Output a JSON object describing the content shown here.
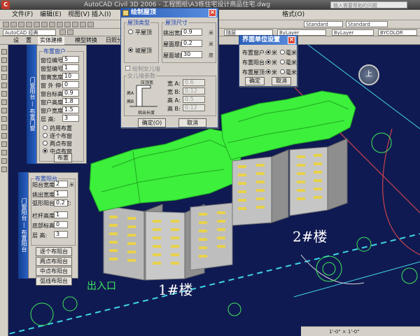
{
  "window": {
    "title": "AutoCAD Civil 3D 2006 - 工程图纸\\A3栋住宅设计商品住宅.dwg",
    "search_placeholder": "输入需要帮助的问题"
  },
  "menu": [
    "文件(F)",
    "编辑(E)",
    "视图(V)",
    "插入(I)",
    "格式(O)"
  ],
  "toolbar": {
    "workspace": "AutoCAD 经典",
    "layer_combo": "ByLayer",
    "style_combo": "Standard",
    "dim_style": "Standard",
    "lineweight": "BYCOLOR",
    "color_combo": "随层"
  },
  "tabs": [
    "设",
    "置",
    "实体建模",
    "模型转换",
    "日照分析",
    "工具"
  ],
  "panels": {
    "window_panel": {
      "side_title": "门窗阳台 — 布置门窗",
      "group_title": "布置窗户",
      "fields": [
        {
          "label": "窗位编号:",
          "value": "5"
        },
        {
          "label": "窗型编号:",
          "value": "1"
        },
        {
          "label": "窗离宽度:",
          "value": "10"
        },
        {
          "label": "窗 外 伸长度:",
          "value": "0"
        },
        {
          "label": "窗台标高:",
          "value": "0.9"
        },
        {
          "label": "窗户高度:",
          "value": "1.8"
        },
        {
          "label": "窗户宽度:",
          "value": "1.5"
        },
        {
          "label": "层    高:",
          "value": "3"
        }
      ],
      "radios": [
        "药用布置",
        "逐个布窗",
        "两点布窗",
        "中点布窗"
      ],
      "radio_selected": 3,
      "button": "布置"
    },
    "balcony_panel": {
      "side_title": "门窗阳台 — 布置阳台",
      "group_title": "布置阳台",
      "fields": [
        {
          "label": "阳台宽度:",
          "value": "2"
        },
        {
          "label": "挑出宽度:",
          "value": "1"
        },
        {
          "label": "弧形阳台 高 度:",
          "value": "0.2"
        },
        {
          "label": "栏杆高度:",
          "value": "1"
        },
        {
          "label": "底部标高:",
          "value": "0"
        },
        {
          "label": "层    高:",
          "value": "3"
        }
      ],
      "buttons": [
        "逐个布阳台",
        "两点布阳台",
        "中点布阳台",
        "弧线布阳台"
      ]
    }
  },
  "dialogs": {
    "roof": {
      "title": "绘制屋顶",
      "type_group": "屋顶类型",
      "types": [
        "平屋顶",
        "坡屋顶"
      ],
      "type_selected": 1,
      "size_group": "屋顶尺寸",
      "size_fields": [
        {
          "label": "挑出宽度:",
          "value": "0.9",
          "unit": "米"
        },
        {
          "label": "屋面厚度:",
          "value": "0.2",
          "unit": "米"
        },
        {
          "label": "屋面坡度:",
          "value": "30",
          "unit": "度"
        }
      ],
      "parapet_check": "绘制女儿墙",
      "parapet_group": "女儿墙参数",
      "parapet_diagram": {
        "top": "压顶宽",
        "bottom": "挑出长度",
        "side_a": "高A",
        "side_b": "高B"
      },
      "parapet_fields": [
        {
          "label": "宽 A:",
          "value": "0.6"
        },
        {
          "label": "宽 B:",
          "value": "0.12"
        },
        {
          "label": "高 A:",
          "value": "0.5"
        },
        {
          "label": "高 B:",
          "value": "0.12"
        }
      ],
      "ok": "确定(O)",
      "cancel": "取消"
    },
    "units": {
      "title": "界面单位设置",
      "rows": [
        {
          "label": "布置窗户:",
          "options": [
            "米",
            "毫米"
          ],
          "selected": 0
        },
        {
          "label": "布置阳台:",
          "options": [
            "米",
            "毫米"
          ],
          "selected": 0
        },
        {
          "label": "布置屋顶:",
          "options": [
            "米",
            "毫米"
          ],
          "selected": 0
        }
      ],
      "ok": "确定",
      "cancel": "取消"
    }
  },
  "scene": {
    "building_1": "1#楼",
    "building_2": "2#楼",
    "entrance": "出入口",
    "compass": "上"
  },
  "status": {
    "coords": "1'-0\" × 1'-0\""
  },
  "colors": {
    "canvas": "#101a52",
    "roof": "#3cf03c",
    "window": "#e8d24a",
    "wall": "#c7c7c7"
  }
}
